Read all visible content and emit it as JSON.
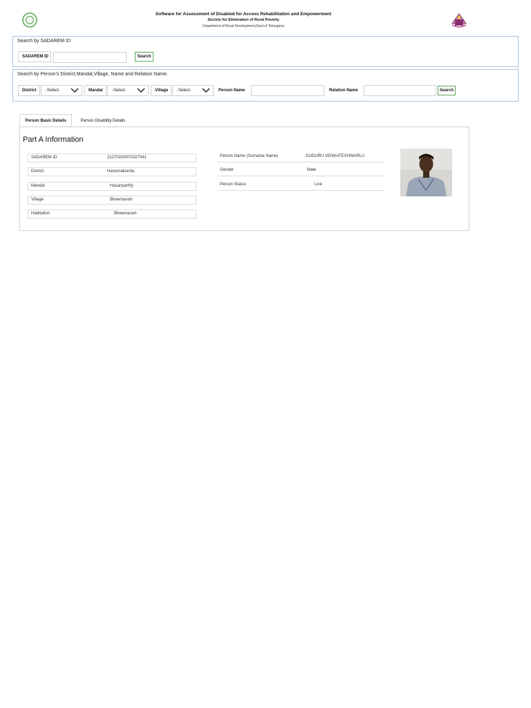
{
  "header": {
    "title": "Software for Assessment of Disabled for Access Rehabilitation and Empowerment",
    "subtitle": "Society for Elimination of Rural Poverty",
    "department": "Department of Rural Development,Govt.of Telangana"
  },
  "search_by_id": {
    "title": "Search by SADAREM ID",
    "label": "SADAREM ID",
    "value": "",
    "button": "Search"
  },
  "search_by_person": {
    "title": "Search by Person's District,Mandal,Village, Name and Relation Name.",
    "district_label": "District",
    "district_value": "-Select-",
    "mandal_label": "Mandal",
    "mandal_value": "-Select-",
    "village_label": "Village",
    "village_value": "-Select-",
    "person_name_label": "Person Name",
    "relation_name_label": "Relation Name",
    "button": "Search"
  },
  "tabs": [
    {
      "label": "Person Basic Details",
      "active": true
    },
    {
      "label": "Person Disability Details",
      "active": false
    }
  ],
  "part_a": {
    "title": "Part A Information",
    "left_fields": [
      {
        "label": "SADAREM ID",
        "value": "21270100070107041"
      },
      {
        "label": "District",
        "value": "Hanumakonda"
      },
      {
        "label": "Mandal",
        "value": "Hasanparthy"
      },
      {
        "label": "Village",
        "value": "Bheemaram"
      },
      {
        "label": "Habitation",
        "value": "Bheemaram"
      }
    ],
    "right_fields": [
      {
        "label": "Person Name (Surname Name)",
        "value": "GUDURU VENKATESHWARLU"
      },
      {
        "label": "Gender",
        "value": "Male"
      },
      {
        "label": "Person Status",
        "value": "Live"
      }
    ]
  },
  "colors": {
    "panel_border": "#a9c3dc",
    "button_border": "#5aa35a"
  },
  "icons": {
    "left_logo": "telangana-emblem-icon",
    "right_logo": "serp-logo-icon",
    "dropdown": "chevron-down-icon"
  }
}
